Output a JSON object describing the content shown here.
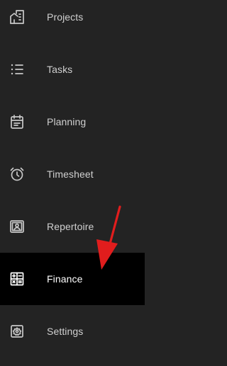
{
  "colors": {
    "background": "#232323",
    "active_background": "#000000",
    "label": "#d0d0d0",
    "active_label": "#ffffff",
    "icon": "#c8c8c8",
    "annotation_arrow": "#e11d1d"
  },
  "sidebar": {
    "items": [
      {
        "label": "Projects",
        "icon": "building-icon",
        "active": false
      },
      {
        "label": "Tasks",
        "icon": "list-icon",
        "active": false
      },
      {
        "label": "Planning",
        "icon": "calendar-icon",
        "active": false
      },
      {
        "label": "Timesheet",
        "icon": "alarm-clock-icon",
        "active": false
      },
      {
        "label": "Repertoire",
        "icon": "contact-card-icon",
        "active": false
      },
      {
        "label": "Finance",
        "icon": "calculator-icon",
        "active": true
      },
      {
        "label": "Settings",
        "icon": "gear-icon",
        "active": false
      }
    ]
  },
  "annotation": {
    "icon": "red-arrow-icon",
    "points_to": "Finance"
  }
}
